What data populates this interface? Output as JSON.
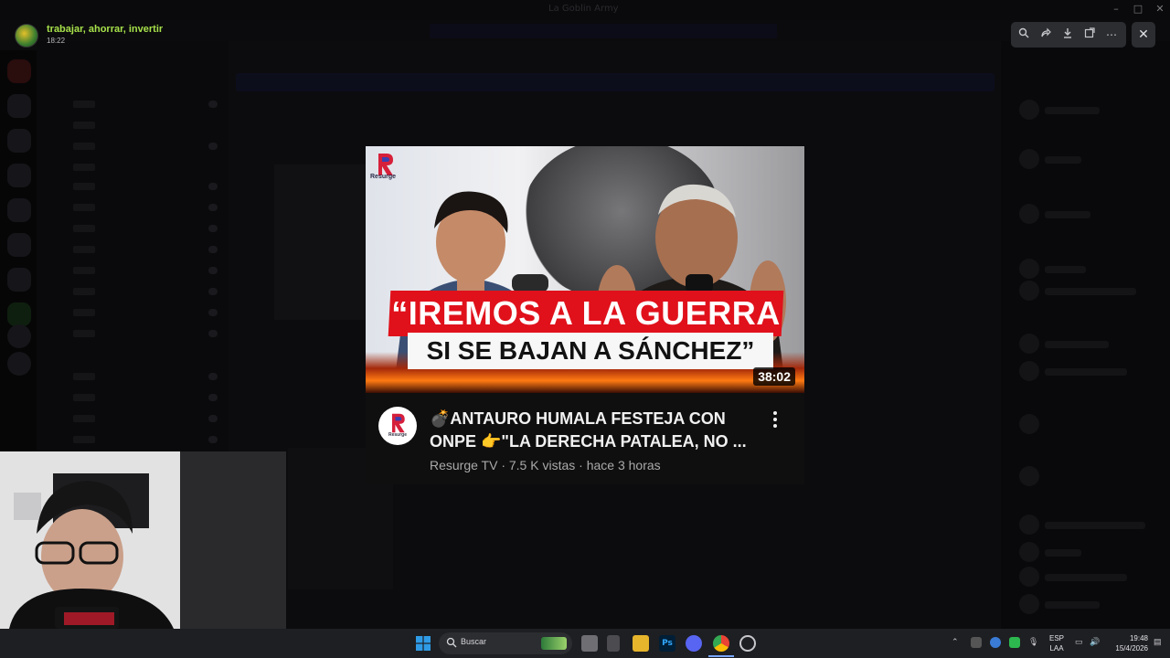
{
  "window": {
    "title": "La Goblin Army"
  },
  "viewer": {
    "author_name": "trabajar, ahorrar, invertir",
    "time": "18:22"
  },
  "video": {
    "thumbnail_line1": "“IREMOS A LA GUERRA",
    "thumbnail_line2": "SI SE BAJAN A SÁNCHEZ”",
    "thumbnail_logo_text": "Resurge",
    "channel_logo_text": "Resurge",
    "duration": "38:02",
    "title": "💣ANTAURO HUMALA FESTEJA CON ONPE 👉\"LA DERECHA PATALEA, NO ...",
    "meta": "Resurge TV · 7.5 K vistas · hace 3 horas"
  },
  "taskbar": {
    "search_placeholder": "Buscar",
    "lang_line1": "ESP",
    "lang_line2": "LAA",
    "clock_time": "19:48",
    "clock_date": "15/4/2026"
  },
  "colors": {
    "accent_name": "#a7e14a",
    "youtube_red": "#e0111b"
  }
}
